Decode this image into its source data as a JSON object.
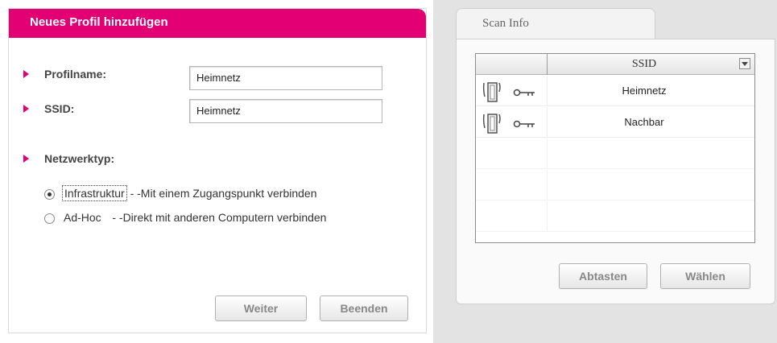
{
  "left_panel": {
    "title": "Neues Profil hinzufügen",
    "profile_name_label": "Profilname:",
    "profile_name_value": "Heimnetz",
    "ssid_label": "SSID:",
    "ssid_value": "Heimnetz",
    "network_type_label": "Netzwerktyp:",
    "options": [
      {
        "name": "Infrastruktur",
        "desc": " - -Mit einem Zugangspunkt verbinden",
        "selected": true
      },
      {
        "name": "Ad-Hoc",
        "desc": "   - -Direkt mit anderen Computern verbinden",
        "selected": false
      }
    ],
    "next_button": "Weiter",
    "finish_button": "Beenden"
  },
  "scan_info": {
    "tab_label": "Scan Info",
    "column_ssid": "SSID",
    "networks": [
      {
        "ssid": "Heimnetz"
      },
      {
        "ssid": "Nachbar"
      }
    ],
    "scan_button": "Abtasten",
    "select_button": "Wählen"
  },
  "colors": {
    "brand": "#e20074"
  }
}
